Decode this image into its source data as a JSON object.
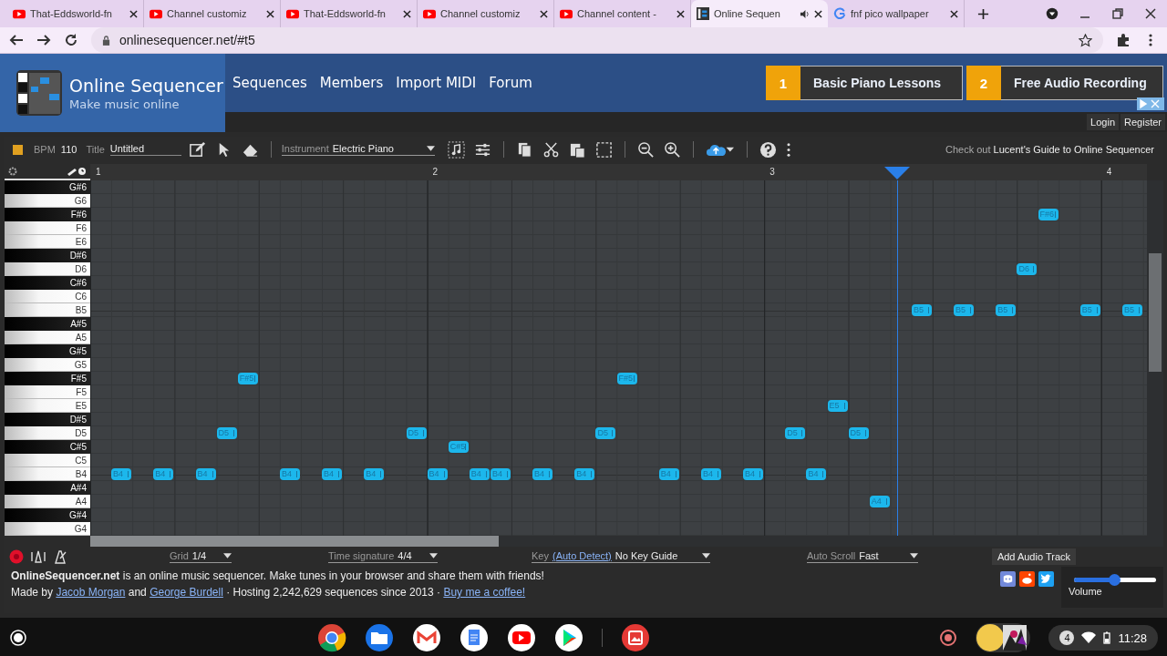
{
  "browser": {
    "tabs": [
      {
        "title": "That-Eddsworld-fn",
        "kind": "youtube",
        "selected": false,
        "audio": false
      },
      {
        "title": "Channel customiz",
        "kind": "youtube",
        "selected": false,
        "audio": false
      },
      {
        "title": "That-Eddsworld-fn",
        "kind": "youtube",
        "selected": false,
        "audio": false
      },
      {
        "title": "Channel customiz",
        "kind": "youtube",
        "selected": false,
        "audio": false
      },
      {
        "title": "Channel content -",
        "kind": "youtube",
        "selected": false,
        "audio": false
      },
      {
        "title": "Online Sequen",
        "kind": "sequencer",
        "selected": true,
        "audio": true
      },
      {
        "title": "fnf pico wallpaper",
        "kind": "google",
        "selected": false,
        "audio": false
      }
    ],
    "url": "onlinesequencer.net/#t5"
  },
  "site": {
    "title": "Online Sequencer",
    "tagline": "Make music online",
    "nav": [
      "Sequences",
      "Members",
      "Import MIDI",
      "Forum"
    ],
    "ads": [
      {
        "number": "1",
        "label": "Basic Piano Lessons"
      },
      {
        "number": "2",
        "label": "Free Audio Recording"
      }
    ],
    "account": [
      "Login",
      "Register"
    ]
  },
  "toolbar": {
    "color": "#e0a020",
    "bpm_label": "BPM",
    "bpm": "110",
    "title_label": "Title",
    "title": "Untitled",
    "instrument_label": "Instrument",
    "instrument": "Electric Piano",
    "promo_prefix": "Check out",
    "promo_link": "Lucent's Guide to Online Sequencer"
  },
  "ruler": [
    "1",
    "2",
    "3",
    "4"
  ],
  "playhead": {
    "level": 0.764
  },
  "keys": [
    {
      "label": "G#6",
      "kind": "black"
    },
    {
      "label": "G6",
      "kind": "white"
    },
    {
      "label": "F#6",
      "kind": "black",
      "notes": [
        {
          "label": "F#6"
        }
      ]
    },
    {
      "label": "F6",
      "kind": "white"
    },
    {
      "label": "E6",
      "kind": "white"
    },
    {
      "label": "D#6",
      "kind": "black"
    },
    {
      "label": "D6",
      "kind": "white",
      "notes": [
        {
          "label": "D6"
        }
      ]
    },
    {
      "label": "C#6",
      "kind": "black"
    },
    {
      "label": "C6",
      "kind": "white"
    },
    {
      "label": "B5",
      "kind": "white",
      "notes": [
        {
          "label": "B5"
        },
        {
          "label": "B5"
        },
        {
          "label": "B5"
        },
        {
          "label": "B5"
        },
        {
          "label": "B5"
        }
      ]
    },
    {
      "label": "A#5",
      "kind": "black"
    },
    {
      "label": "A5",
      "kind": "white"
    },
    {
      "label": "G#5",
      "kind": "black"
    },
    {
      "label": "G5",
      "kind": "white"
    },
    {
      "label": "F#5",
      "kind": "black",
      "notes": [
        {
          "label": "F#5"
        },
        {
          "label": "F#5"
        }
      ]
    },
    {
      "label": "F5",
      "kind": "white"
    },
    {
      "label": "E5",
      "kind": "white",
      "notes": [
        {
          "label": "E5"
        }
      ]
    },
    {
      "label": "D#5",
      "kind": "black"
    },
    {
      "label": "D5",
      "kind": "white",
      "notes": [
        {
          "label": "D5"
        },
        {
          "label": "D5"
        },
        {
          "label": "D5"
        },
        {
          "label": "D5"
        },
        {
          "label": "D5"
        }
      ]
    },
    {
      "label": "C#5",
      "kind": "black",
      "notes": [
        {
          "label": "C#5"
        }
      ]
    },
    {
      "label": "C5",
      "kind": "white"
    },
    {
      "label": "B4",
      "kind": "white",
      "notes": [
        {
          "label": "B4"
        },
        {
          "label": "B4"
        },
        {
          "label": "B4"
        },
        {
          "label": "B4"
        },
        {
          "label": "B4"
        },
        {
          "label": "B4"
        },
        {
          "label": "B4"
        },
        {
          "label": "B4"
        },
        {
          "label": "B4"
        },
        {
          "label": "B4"
        },
        {
          "label": "B4"
        },
        {
          "label": "B4"
        },
        {
          "label": "B4"
        },
        {
          "label": "B4"
        },
        {
          "label": "B4"
        }
      ]
    },
    {
      "label": "A#4",
      "kind": "black"
    },
    {
      "label": "A4",
      "kind": "white",
      "notes": [
        {
          "label": "A4"
        }
      ]
    },
    {
      "label": "G#4",
      "kind": "black"
    },
    {
      "label": "G4",
      "kind": "white"
    }
  ],
  "controls": [
    {
      "label": "Grid",
      "value": "1/4"
    },
    {
      "label": "Time signature",
      "value": "4/4"
    },
    {
      "label": "Key",
      "link": "(Auto Detect)",
      "value": "No Key Guide"
    },
    {
      "label": "Auto Scroll",
      "value": "Fast"
    }
  ],
  "add_track": "Add Audio Track",
  "footer": {
    "about": "**OnlineSequencer.net** is an online music sequencer. Make tunes in your browser and share them with friends!",
    "credits": [
      {
        "kind": "text",
        "text": "Made by"
      },
      {
        "kind": "link",
        "text": "Jacob Morgan"
      },
      {
        "kind": "text",
        "text": "and"
      },
      {
        "kind": "link",
        "text": "George Burdell"
      },
      {
        "kind": "text",
        "text": "· Hosting 2,242,629 sequences since 2013 ·"
      },
      {
        "kind": "link",
        "text": "Buy me a coffee!"
      }
    ],
    "volume": {
      "label": "Volume",
      "level": 0.5
    }
  },
  "taskbar": {
    "notifications": "4",
    "time": "11:28"
  }
}
